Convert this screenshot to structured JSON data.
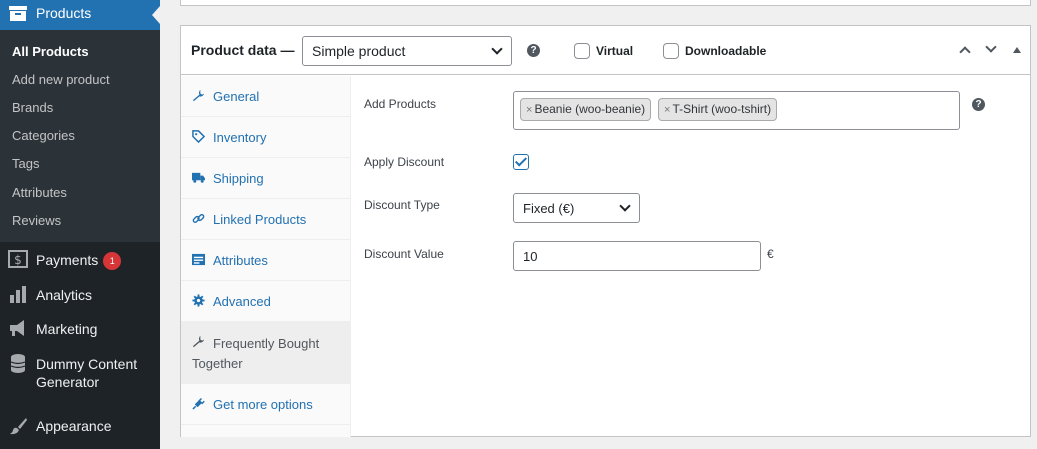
{
  "sidebar": {
    "active_menu": "Products",
    "submenu": [
      "All Products",
      "Add new product",
      "Brands",
      "Categories",
      "Tags",
      "Attributes",
      "Reviews"
    ],
    "current_submenu": "All Products",
    "menu": [
      {
        "label": "Payments",
        "icon": "dollar-icon",
        "badge": "1"
      },
      {
        "label": "Analytics",
        "icon": "bar-chart-icon"
      },
      {
        "label": "Marketing",
        "icon": "megaphone-icon"
      },
      {
        "label": "Dummy Content",
        "label2": "Generator",
        "icon": "database-icon"
      },
      {
        "label": "Appearance",
        "icon": "paintbrush-icon"
      }
    ]
  },
  "product_data": {
    "title": "Product data —",
    "product_type": "Simple product",
    "virtual_label": "Virtual",
    "downloadable_label": "Downloadable",
    "help_glyph": "?",
    "tabs": [
      {
        "label": "General",
        "icon": "wrench-icon"
      },
      {
        "label": "Inventory",
        "icon": "tag-icon"
      },
      {
        "label": "Shipping",
        "icon": "truck-icon"
      },
      {
        "label": "Linked Products",
        "icon": "link-icon"
      },
      {
        "label": "Attributes",
        "icon": "list-icon"
      },
      {
        "label": "Advanced",
        "icon": "gear-icon"
      },
      {
        "label": "Frequently Bought",
        "label2": "Together",
        "icon": "wrench-icon",
        "active": true
      },
      {
        "label": "Get more options",
        "icon": "plugin-icon"
      }
    ],
    "fields": {
      "add_products_label": "Add Products",
      "tags": [
        "Beanie (woo-beanie)",
        "T-Shirt (woo-tshirt)"
      ],
      "tag_remove_glyph": "×",
      "apply_discount_label": "Apply Discount",
      "apply_discount_checked": true,
      "discount_type_label": "Discount Type",
      "discount_type_value": "Fixed (€)",
      "discount_value_label": "Discount Value",
      "discount_value": "10",
      "currency_symbol": "€"
    }
  },
  "colors": {
    "admin_bg": "#1d2327",
    "submenu_bg": "#2c3338",
    "accent": "#2271b1",
    "badge": "#d63638"
  }
}
